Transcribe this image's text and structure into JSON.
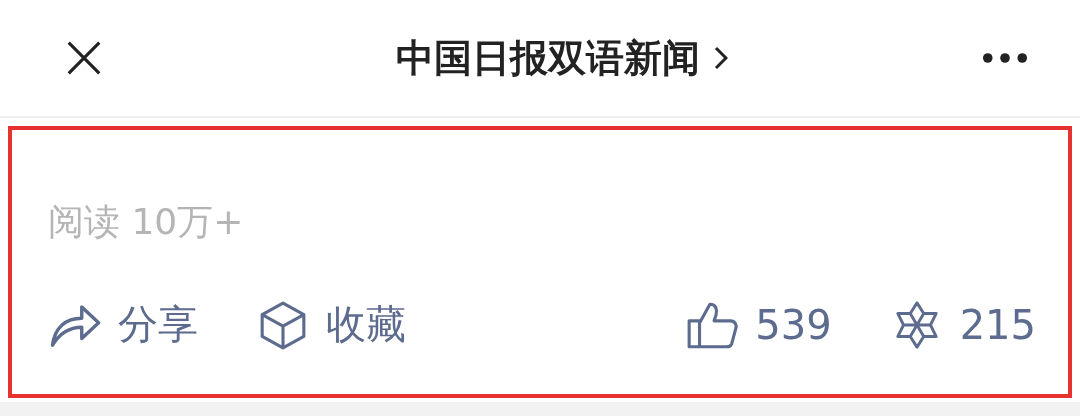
{
  "header": {
    "title": "中国日报双语新闻"
  },
  "stats": {
    "reads": "阅读 10万+"
  },
  "actions": [
    {
      "kind": "share",
      "label": "分享"
    },
    {
      "kind": "favorite",
      "label": "收藏"
    },
    {
      "kind": "like",
      "label": "539"
    },
    {
      "kind": "wow",
      "label": "215"
    }
  ]
}
